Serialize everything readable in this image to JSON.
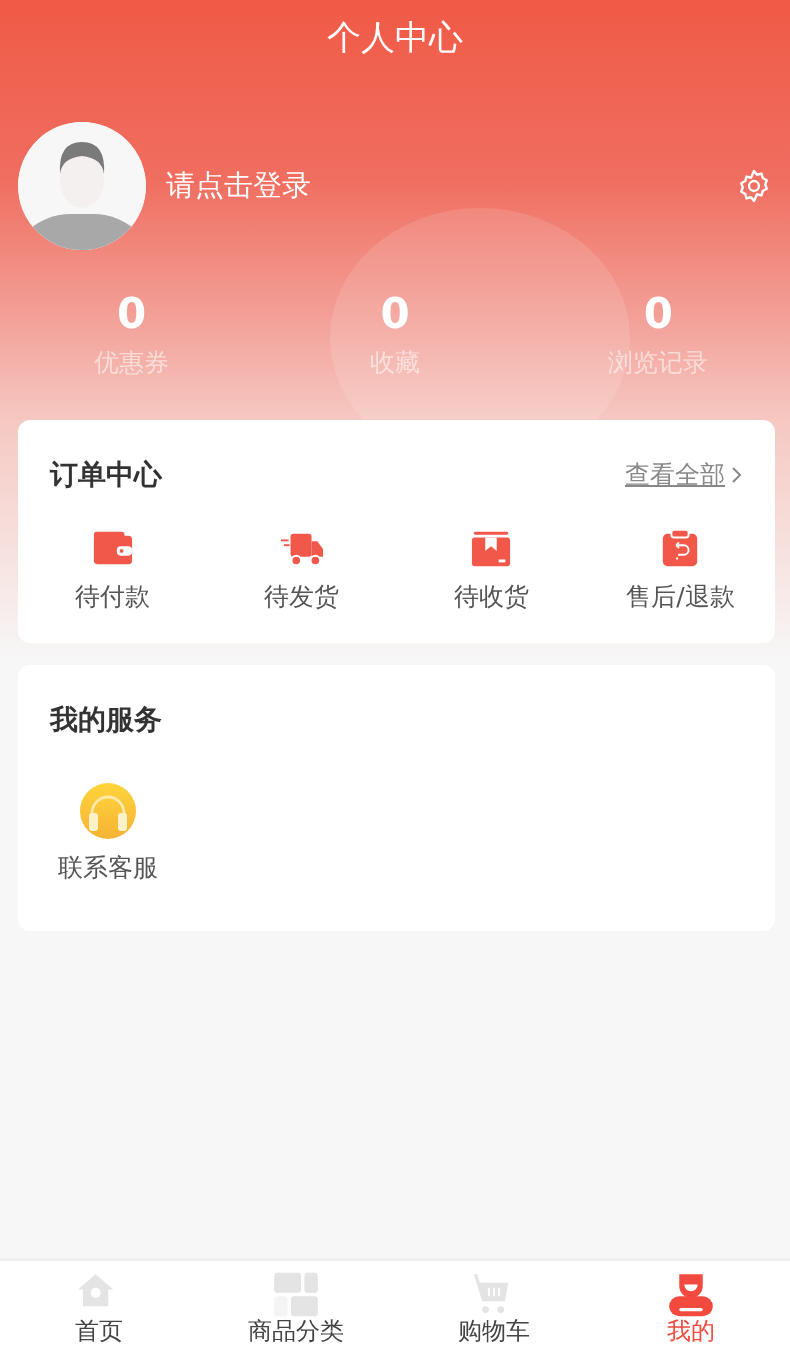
{
  "header": {
    "title": "个人中心"
  },
  "profile": {
    "login_prompt": "请点击登录"
  },
  "stats": [
    {
      "value": "0",
      "label": "优惠券"
    },
    {
      "value": "0",
      "label": "收藏"
    },
    {
      "value": "0",
      "label": "浏览记录"
    }
  ],
  "orders": {
    "title": "订单中心",
    "view_all": "查看全部",
    "items": [
      {
        "kind": "wallet",
        "label": "待付款"
      },
      {
        "kind": "truck",
        "label": "待发货"
      },
      {
        "kind": "box",
        "label": "待收货"
      },
      {
        "kind": "refund",
        "label": "售后/退款"
      }
    ]
  },
  "services": {
    "title": "我的服务",
    "items": [
      {
        "kind": "headset",
        "label": "联系客服"
      }
    ]
  },
  "tab_bar": [
    {
      "kind": "home",
      "label": "首页",
      "selected": false
    },
    {
      "kind": "category",
      "label": "商品分类",
      "selected": false
    },
    {
      "kind": "cart",
      "label": "购物车",
      "selected": false
    },
    {
      "kind": "profile",
      "label": "我的",
      "selected": true
    }
  ]
}
